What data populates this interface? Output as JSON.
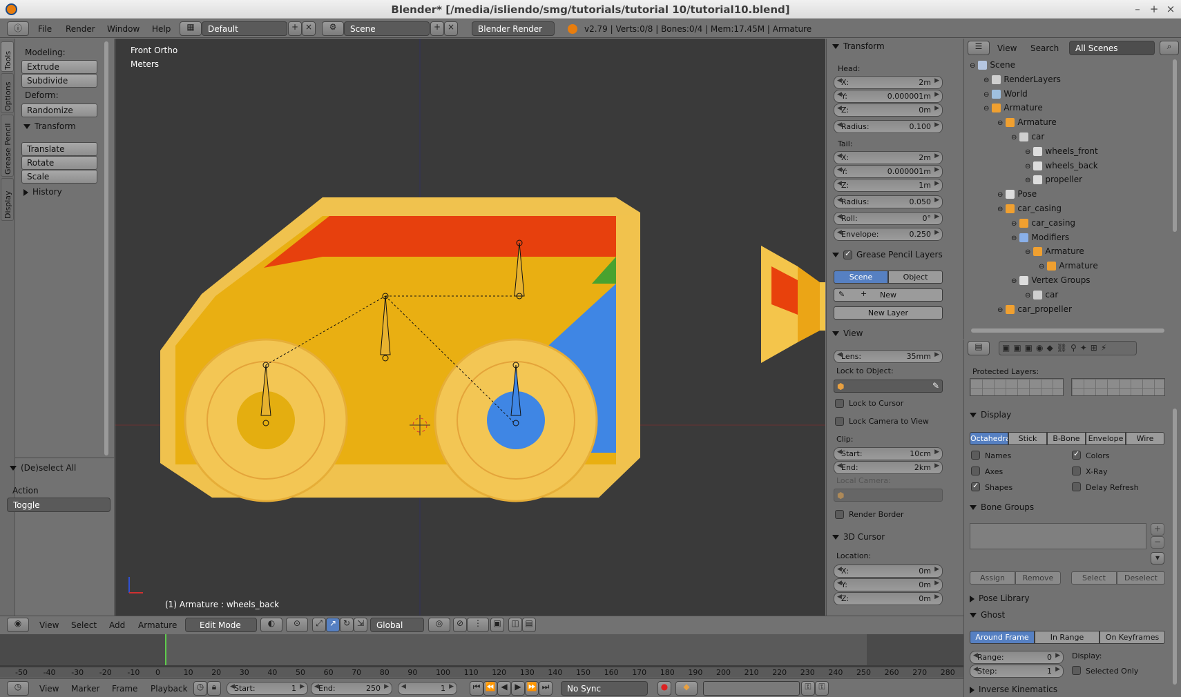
{
  "window": {
    "title": "Blender* [/media/isliendo/smg/tutorials/tutorial 10/tutorial10.blend]"
  },
  "topbar": {
    "menus": [
      "File",
      "Render",
      "Window",
      "Help"
    ],
    "layout": "Default",
    "scene": "Scene",
    "engine": "Blender Render",
    "stats": "v2.79 | Verts:0/8 | Bones:0/4 | Mem:17.45M | Armature"
  },
  "lefttabs": [
    "Tools",
    "Options",
    "Grease Pencil",
    "Display"
  ],
  "toolshelf": {
    "modeling_label": "Modeling:",
    "extrude": "Extrude",
    "subdivide": "Subdivide",
    "deform_label": "Deform:",
    "randomize": "Randomize",
    "transform_header": "Transform",
    "translate": "Translate",
    "rotate": "Rotate",
    "scale": "Scale",
    "history_header": "History",
    "deselect_header": "(De)select All",
    "action_label": "Action",
    "action_value": "Toggle"
  },
  "viewport": {
    "view_name": "Front Ortho",
    "units": "Meters",
    "status": "(1) Armature : wheels_back"
  },
  "npanel": {
    "transform_header": "Transform",
    "head_label": "Head:",
    "head": {
      "x": "2m",
      "y": "0.000001m",
      "z": "0m"
    },
    "head_radius": "0.100",
    "tail_label": "Tail:",
    "tail": {
      "x": "2m",
      "y": "0.000001m",
      "z": "1m"
    },
    "tail_radius": "0.050",
    "roll": "0°",
    "envelope": "0.250",
    "gp_header": "Grease Pencil Layers",
    "gp_scene": "Scene",
    "gp_object": "Object",
    "gp_new": "New",
    "gp_new_layer": "New Layer",
    "view_header": "View",
    "lens": "35mm",
    "lock_to_object": "Lock to Object:",
    "lock_to_cursor": "Lock to Cursor",
    "lock_camera": "Lock Camera to View",
    "clip_label": "Clip:",
    "clip_start": "10cm",
    "clip_end": "2km",
    "local_camera": "Local Camera:",
    "render_border": "Render Border",
    "cursor_header": "3D Cursor",
    "location_label": "Location:",
    "cursor": {
      "x": "0m",
      "y": "0m",
      "z": "0m"
    },
    "labels": {
      "x": "X:",
      "y": "Y:",
      "z": "Z:",
      "radius": "Radius:",
      "roll": "Roll:",
      "envelope": "Envelope:",
      "lens": "Lens:",
      "start": "Start:",
      "end": "End:"
    }
  },
  "outliner": {
    "menus": [
      "View",
      "Search"
    ],
    "filter": "All Scenes",
    "items": [
      {
        "label": "Scene",
        "indent": 0
      },
      {
        "label": "RenderLayers",
        "indent": 1
      },
      {
        "label": "World",
        "indent": 1
      },
      {
        "label": "Armature",
        "indent": 1
      },
      {
        "label": "Armature",
        "indent": 2
      },
      {
        "label": "car",
        "indent": 3
      },
      {
        "label": "wheels_front",
        "indent": 4
      },
      {
        "label": "wheels_back",
        "indent": 4
      },
      {
        "label": "propeller",
        "indent": 4
      },
      {
        "label": "Pose",
        "indent": 2
      },
      {
        "label": "car_casing",
        "indent": 2
      },
      {
        "label": "car_casing",
        "indent": 3
      },
      {
        "label": "Modifiers",
        "indent": 3
      },
      {
        "label": "Armature",
        "indent": 4
      },
      {
        "label": "Armature",
        "indent": 5
      },
      {
        "label": "Vertex Groups",
        "indent": 3
      },
      {
        "label": "car",
        "indent": 4
      },
      {
        "label": "car_propeller",
        "indent": 2
      }
    ]
  },
  "properties": {
    "protected_layers": "Protected Layers:",
    "display_header": "Display",
    "display_modes": [
      "Octahedral",
      "Stick",
      "B-Bone",
      "Envelope",
      "Wire"
    ],
    "names": "Names",
    "axes": "Axes",
    "shapes": "Shapes",
    "colors": "Colors",
    "xray": "X-Ray",
    "delay_refresh": "Delay Refresh",
    "bone_groups_header": "Bone Groups",
    "assign": "Assign",
    "remove": "Remove",
    "select": "Select",
    "deselect": "Deselect",
    "pose_library": "Pose Library",
    "ghost_header": "Ghost",
    "ghost_modes": [
      "Around Frame",
      "In Range",
      "On Keyframes"
    ],
    "range_label": "Range:",
    "range": "0",
    "step_label": "Step:",
    "step": "1",
    "display_label": "Display:",
    "selected_only": "Selected Only",
    "ik_header": "Inverse Kinematics"
  },
  "view3d_header": {
    "menus": [
      "View",
      "Select",
      "Add",
      "Armature"
    ],
    "mode": "Edit Mode",
    "orientation": "Global"
  },
  "timeline": {
    "ticks": [
      "-50",
      "-40",
      "-30",
      "-20",
      "-10",
      "0",
      "10",
      "20",
      "30",
      "40",
      "50",
      "60",
      "70",
      "80",
      "90",
      "100",
      "110",
      "120",
      "130",
      "140",
      "150",
      "160",
      "170",
      "180",
      "190",
      "200",
      "210",
      "220",
      "230",
      "240",
      "250",
      "260",
      "270",
      "280"
    ],
    "menus": [
      "View",
      "Marker",
      "Frame",
      "Playback"
    ],
    "start_label": "Start:",
    "start": "1",
    "end_label": "End:",
    "end": "250",
    "current": "1",
    "sync": "No Sync"
  }
}
